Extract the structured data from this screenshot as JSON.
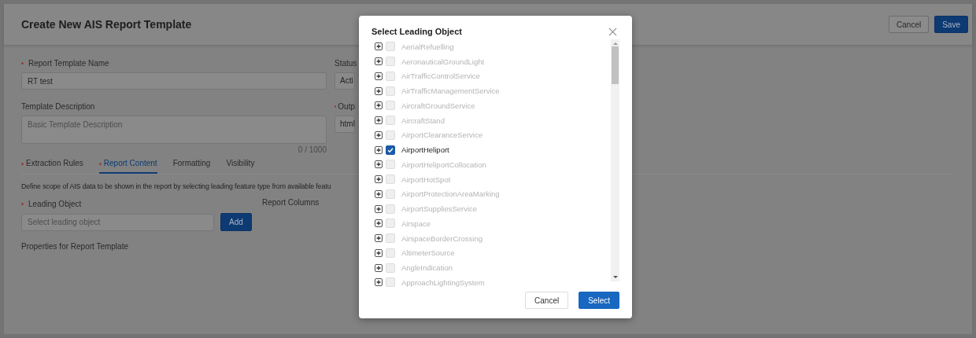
{
  "page": {
    "title": "Create New AIS Report Template",
    "actions": [
      {
        "label": "Cancel",
        "kind": "secondary"
      },
      {
        "label": "Save",
        "kind": "primary"
      }
    ],
    "form": {
      "name_field": {
        "label": "Report Template Name",
        "required": true,
        "value": "RT test"
      },
      "status_field": {
        "label": "Status",
        "value": "Acti"
      },
      "description_field": {
        "label": "Template Description",
        "placeholder": "Basic Template Description",
        "counter": "0 / 1000"
      },
      "output_field": {
        "label": "Outp",
        "required": true,
        "value": "html"
      }
    },
    "tabs": [
      {
        "label": "Extraction Rules",
        "required": true,
        "selected": false
      },
      {
        "label": "Report Content",
        "required": true,
        "selected": true
      },
      {
        "label": "Formatting",
        "required": false,
        "selected": false
      },
      {
        "label": "Visibility",
        "required": false,
        "selected": false
      }
    ],
    "intro": "Define scope of AIS data to be shown in the report by selecting leading feature type from available featu",
    "leading_object": {
      "label": "Leading Object",
      "required": true,
      "placeholder": "Select leading object",
      "button": "Add"
    },
    "report_columns_label": "Report Columns",
    "properties_label": "Properties for Report Template"
  },
  "dialog": {
    "title": "Select Leading Object",
    "items": [
      {
        "label": "AerialRefuelling",
        "checked": false
      },
      {
        "label": "AeronauticalGroundLight",
        "checked": false
      },
      {
        "label": "AirTrafficControlService",
        "checked": false
      },
      {
        "label": "AirTrafficManagementService",
        "checked": false
      },
      {
        "label": "AircraftGroundService",
        "checked": false
      },
      {
        "label": "AircraftStand",
        "checked": false
      },
      {
        "label": "AirportClearanceService",
        "checked": false
      },
      {
        "label": "AirportHeliport",
        "checked": true
      },
      {
        "label": "AirportHeliportCollocation",
        "checked": false
      },
      {
        "label": "AirportHotSpot",
        "checked": false
      },
      {
        "label": "AirportProtectionAreaMarking",
        "checked": false
      },
      {
        "label": "AirportSuppliesService",
        "checked": false
      },
      {
        "label": "Airspace",
        "checked": false
      },
      {
        "label": "AirspaceBorderCrossing",
        "checked": false
      },
      {
        "label": "AltimeterSource",
        "checked": false
      },
      {
        "label": "AngleIndication",
        "checked": false
      },
      {
        "label": "ApproachLightingSystem",
        "checked": false
      }
    ],
    "buttons": [
      {
        "label": "Cancel",
        "kind": "secondary"
      },
      {
        "label": "Select",
        "kind": "primary"
      }
    ]
  }
}
